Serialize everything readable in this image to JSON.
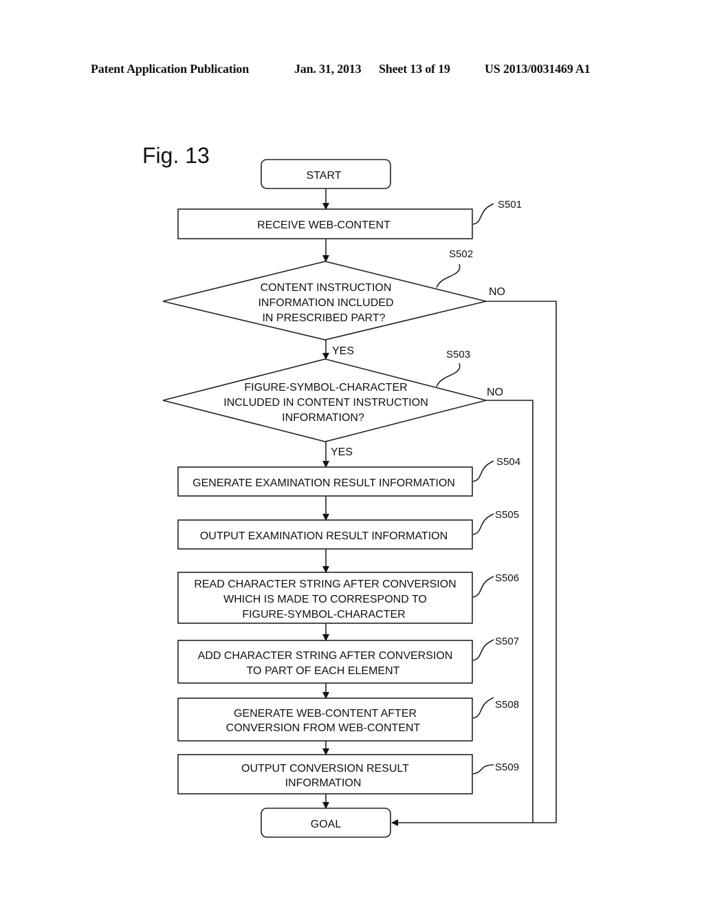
{
  "header": {
    "publication": "Patent Application Publication",
    "date": "Jan. 31, 2013",
    "sheet": "Sheet 13 of 19",
    "patent_number": "US 2013/0031469 A1"
  },
  "figure_label": "Fig. 13",
  "flowchart": {
    "start": "START",
    "goal": "GOAL",
    "steps": {
      "s501": {
        "id": "S501",
        "lines": [
          "RECEIVE WEB-CONTENT"
        ]
      },
      "s502": {
        "id": "S502",
        "lines": [
          "CONTENT INSTRUCTION",
          "INFORMATION INCLUDED",
          "IN PRESCRIBED PART?"
        ],
        "yes": "YES",
        "no": "NO"
      },
      "s503": {
        "id": "S503",
        "lines": [
          "FIGURE-SYMBOL-CHARACTER",
          "INCLUDED IN CONTENT INSTRUCTION",
          "INFORMATION?"
        ],
        "yes": "YES",
        "no": "NO"
      },
      "s504": {
        "id": "S504",
        "lines": [
          "GENERATE EXAMINATION RESULT INFORMATION"
        ]
      },
      "s505": {
        "id": "S505",
        "lines": [
          "OUTPUT EXAMINATION RESULT INFORMATION"
        ]
      },
      "s506": {
        "id": "S506",
        "lines": [
          "READ CHARACTER STRING AFTER CONVERSION",
          "WHICH IS MADE TO CORRESPOND TO",
          "FIGURE-SYMBOL-CHARACTER"
        ]
      },
      "s507": {
        "id": "S507",
        "lines": [
          "ADD CHARACTER STRING AFTER CONVERSION",
          "TO PART OF EACH ELEMENT"
        ]
      },
      "s508": {
        "id": "S508",
        "lines": [
          "GENERATE WEB-CONTENT AFTER",
          "CONVERSION FROM WEB-CONTENT"
        ]
      },
      "s509": {
        "id": "S509",
        "lines": [
          "OUTPUT CONVERSION RESULT",
          "INFORMATION"
        ]
      }
    }
  }
}
